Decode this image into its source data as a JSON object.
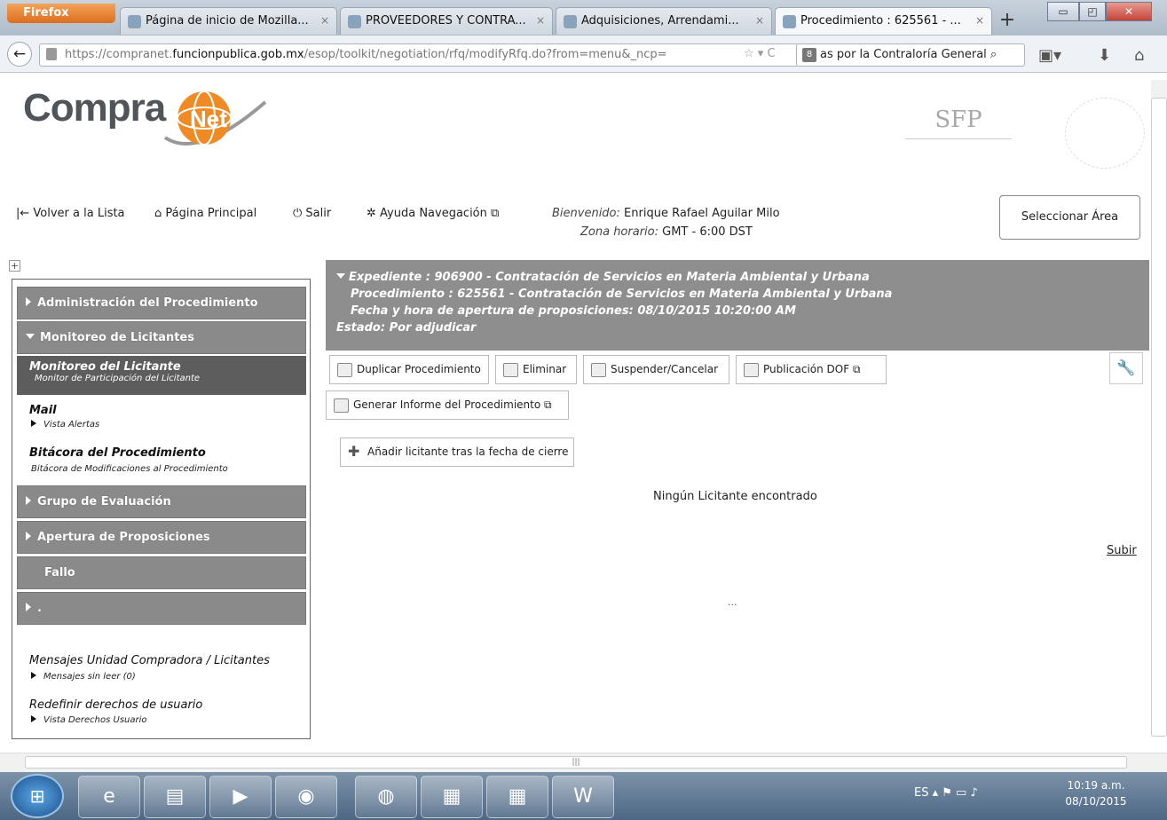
{
  "browser": {
    "app_button": "Firefox",
    "tabs": [
      {
        "title": "Página de inicio de Mozilla..."
      },
      {
        "title": "PROVEEDORES Y CONTRA..."
      },
      {
        "title": "Adquisiciones, Arrendami..."
      },
      {
        "title": "Procedimiento : 625561 - ..."
      }
    ],
    "url_prefix": "https://compranet.",
    "url_domain": "funcionpublica.gob.mx",
    "url_rest": "/esop/toolkit/negotiation/rfq/modifyRfq.do?from=menu&_ncp=",
    "search_text": "as por la Contraloría General"
  },
  "header": {
    "logo_text": "Compra",
    "logo_mark": "Net",
    "agency_text": "SFP",
    "nav": {
      "back_to_list": "Volver a la Lista",
      "main_page": "Página Principal",
      "exit": "Salir",
      "help": "Ayuda Navegación"
    },
    "welcome_label": "Bienvenido:",
    "welcome_user": "Enrique Rafael Aguilar Milo",
    "timezone_label": "Zona horario:",
    "timezone_value": "GMT - 6:00 DST",
    "select_area": "Seleccionar Área"
  },
  "sidebar": {
    "admin_procedure": "Administración del Procedimiento",
    "bidder_monitoring": "Monitoreo de Licitantes",
    "selected_title": "Monitoreo del Licitante",
    "selected_sub": "Monitor de Participación del Licitante",
    "mail_title": "Mail",
    "mail_sub": "Vista Alertas",
    "log_title": "Bitácora del Procedimiento",
    "log_sub": "Bitácora de Modificaciones al Procedimiento",
    "eval_group": "Grupo de Evaluación",
    "opening": "Apertura de Proposiciones",
    "ruling": "Fallo",
    "dot_item": ".",
    "messages_title": "Mensajes Unidad Compradora / Licitantes",
    "messages_sub": "Mensajes sin leer (0)",
    "rights_title": "Redefinir derechos de usuario",
    "rights_sub": "Vista Derechos Usuario"
  },
  "banner": {
    "line1": "Expediente : 906900 - Contratación de Servicios en Materia Ambiental y Urbana",
    "line2": "Procedimiento : 625561 - Contratación de Servicios en Materia Ambiental y Urbana",
    "line3": "Fecha y hora de apertura de proposiciones: 08/10/2015 10:20:00 AM",
    "line4": "Estado: Por adjudicar"
  },
  "actions": {
    "duplicate": "Duplicar Procedimiento",
    "delete": "Eliminar",
    "suspend": "Suspender/Cancelar",
    "publish": "Publicación DOF",
    "report": "Generar Informe del Procedimiento",
    "add_bidder": "Añadir licitante tras la fecha de cierre"
  },
  "main": {
    "empty_message": "Ningún Licitante encontrado",
    "up_link": "Subir",
    "ellipsis": "..."
  },
  "taskbar": {
    "lang": "ES",
    "time": "10:19 a.m.",
    "date": "08/10/2015"
  }
}
